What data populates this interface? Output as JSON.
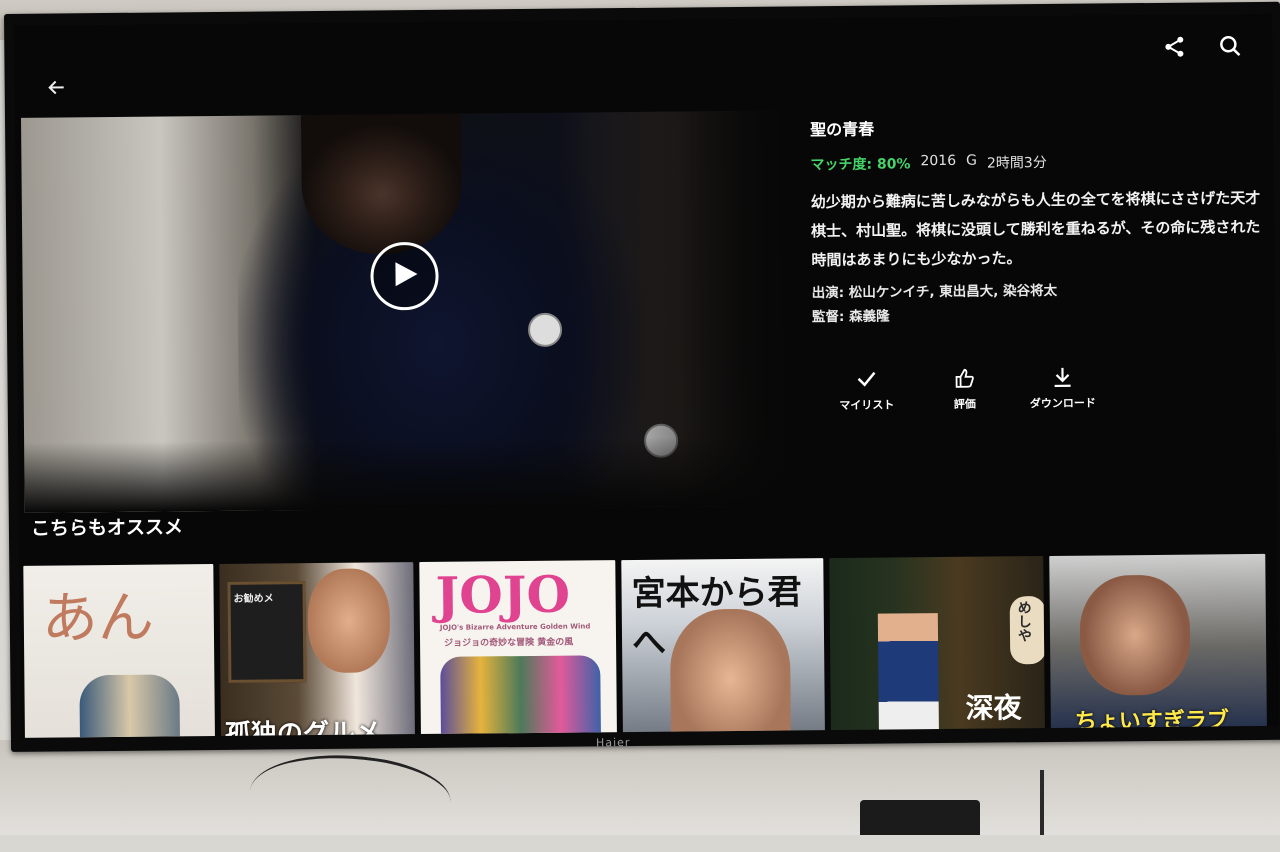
{
  "movie": {
    "title": "聖の青春",
    "match": "マッチ度: 80%",
    "year": "2016",
    "rating": "G",
    "duration": "2時間3分",
    "synopsis": "幼少期から難病に苦しみながらも人生の全てを将棋にささげた天才棋士、村山聖。将棋に没頭して勝利を重ねるが、その命に残された時間はあまりにも少なかった。",
    "cast": "出演: 松山ケンイチ, 東出昌大, 染谷将太",
    "director": "監督: 森義隆"
  },
  "actions": {
    "mylist": "マイリスト",
    "rate": "評価",
    "download": "ダウンロード"
  },
  "recommend": {
    "heading": "こちらもオススメ",
    "thumbs": [
      {
        "text": "あん"
      },
      {
        "text": "孤独のグルメ",
        "board": "お勧めメ"
      },
      {
        "text": "JOJO",
        "sub": "JOJO's Bizarre Adventure Golden Wind",
        "jp": "ジョジョの奇妙な冒険 黄金の風"
      },
      {
        "text": "宮本から君へ"
      },
      {
        "text": "めしや",
        "sub": "深夜"
      },
      {
        "text": "ちょいすぎラブ"
      }
    ]
  },
  "tv_brand": "Haier",
  "colors": {
    "match": "#46d369",
    "background": "#070707"
  },
  "icons": [
    "back-arrow-icon",
    "share-icon",
    "search-icon",
    "play-icon",
    "check-icon",
    "thumbs-up-icon",
    "download-icon"
  ]
}
